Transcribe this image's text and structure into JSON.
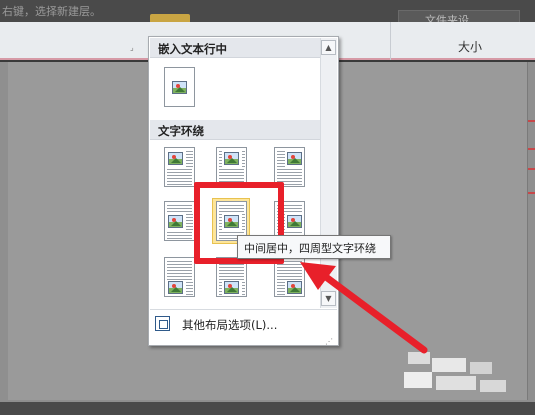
{
  "background": {
    "top_text": "右键，选择新建层。",
    "top_button_label": "文件夹设",
    "ribbon_size_label": "大小"
  },
  "wrap_menu": {
    "section_inline_label": "嵌入文本行中",
    "section_wrap_label": "文字环绕",
    "more_options_label": "其他布局选项(L)...",
    "scroll_up_glyph": "▲",
    "scroll_down_glyph": "▼",
    "gallery": [
      {
        "name": "inline",
        "row": 0,
        "col": 0,
        "selected": false
      },
      {
        "name": "top-left",
        "row": 1,
        "col": 0,
        "selected": false
      },
      {
        "name": "top-center",
        "row": 1,
        "col": 1,
        "selected": false
      },
      {
        "name": "top-right",
        "row": 1,
        "col": 2,
        "selected": false
      },
      {
        "name": "middle-left",
        "row": 2,
        "col": 0,
        "selected": false
      },
      {
        "name": "middle-center",
        "row": 2,
        "col": 1,
        "selected": true
      },
      {
        "name": "middle-right",
        "row": 2,
        "col": 2,
        "selected": false
      },
      {
        "name": "bottom-left",
        "row": 3,
        "col": 0,
        "selected": false
      },
      {
        "name": "bottom-center",
        "row": 3,
        "col": 1,
        "selected": false
      },
      {
        "name": "bottom-right",
        "row": 3,
        "col": 2,
        "selected": false
      }
    ]
  },
  "tooltip": {
    "text": "中间居中，四周型文字环绕"
  },
  "colors": {
    "highlight_red": "#e8202a",
    "selected_fill": "#fde59a"
  }
}
